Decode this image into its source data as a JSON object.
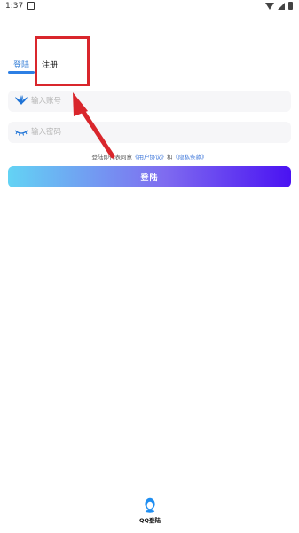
{
  "status_bar": {
    "time": "1:37"
  },
  "tabs": {
    "login": "登陆",
    "register": "注册"
  },
  "account_field": {
    "placeholder": "输入账号",
    "icon": "wings-icon"
  },
  "password_field": {
    "placeholder": "输入密码",
    "icon": "closed-eye-icon"
  },
  "agreement": {
    "prefix": "登陆即代表同意",
    "user_agreement": "《用户协议》",
    "conjunction": "和",
    "privacy_policy": "《隐私条款》"
  },
  "login_button": {
    "label": "登陆"
  },
  "qq_login": {
    "label": "QQ登陆",
    "icon": "qq-penguin-icon"
  },
  "annotation": {
    "highlighted_element": "tab-register",
    "color": "#d9262c"
  },
  "colors": {
    "accent": "#2d7fe4",
    "gradient_start": "#63d3f4",
    "gradient_end": "#4a12f2"
  }
}
